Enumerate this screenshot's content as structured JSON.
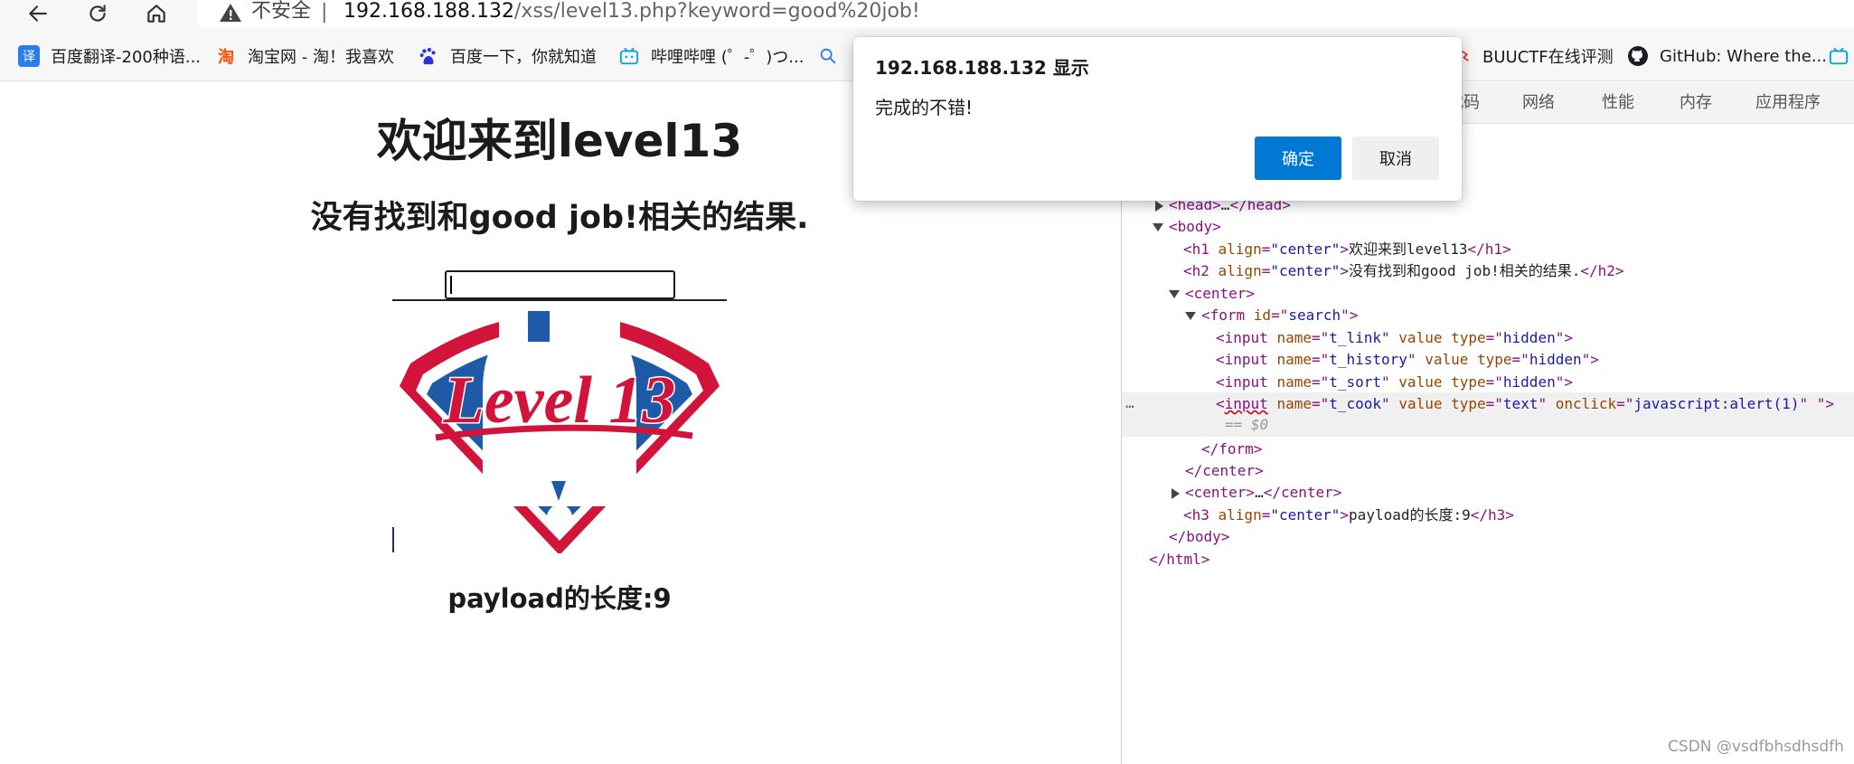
{
  "toolbar": {
    "security_label": "不安全",
    "separator": "|",
    "url_host": "192.168.188.132",
    "url_path": "/xss/level13.php?keyword=good%20job!"
  },
  "favorites": [
    {
      "label": "百度翻译-200种语...",
      "icon": "translate-icon",
      "icon_text": "译",
      "color": "#2b7de9"
    },
    {
      "label": "淘宝网 - 淘！我喜欢",
      "icon": "taobao-icon",
      "icon_text": "淘",
      "color": "#ff5000"
    },
    {
      "label": "百度一下，你就知道",
      "icon": "baidu-paw-icon",
      "icon_text": "",
      "color": "#2932e1"
    },
    {
      "label": "哔哩哔哩 (゜-゜)つ...",
      "icon": "bilibili-icon",
      "icon_text": "",
      "color": "#00a1d6"
    },
    {
      "label": "BUUCTF在线评测",
      "icon": "buuctf-icon",
      "icon_text": "",
      "color": "#e0383e"
    },
    {
      "label": "GitHub: Where the...",
      "icon": "github-icon",
      "icon_text": "",
      "color": "#1b1f23"
    }
  ],
  "page": {
    "h1": "欢迎来到level13",
    "h2": "没有找到和good job!相关的结果.",
    "h3": "payload的长度:9",
    "logo_text": "Level 13"
  },
  "devtools": {
    "tabs": [
      "代码",
      "网络",
      "性能",
      "内存",
      "应用程序"
    ],
    "dom": {
      "head": [
        "<",
        "head",
        ">…</",
        "head",
        ">"
      ],
      "body_open": "body",
      "h1_text": "欢迎来到level13",
      "h2_text": "没有找到和good job!相关的结果.",
      "center": "center",
      "form_id": "search",
      "inputs": [
        {
          "name": "t_link",
          "type": "hidden"
        },
        {
          "name": "t_history",
          "type": "hidden"
        },
        {
          "name": "t_sort",
          "type": "hidden"
        },
        {
          "name": "t_cook",
          "type": "text",
          "onclick": "javascript:alert(1)"
        }
      ],
      "selected_suffix": "== $0",
      "h3_text": "payload的长度:9",
      "attr_align": "align",
      "attr_align_val": "\"center\"",
      "attr_id": "id",
      "attr_name": "name",
      "attr_value": "value",
      "attr_type": "type",
      "attr_onclick": "onclick",
      "ellipsis": "…",
      "dots": "···"
    }
  },
  "dialog": {
    "title": "192.168.188.132 显示",
    "message": "完成的不错!",
    "ok_label": "确定",
    "cancel_label": "取消"
  },
  "watermark": "CSDN @vsdfbhsdhsdfh",
  "colors": {
    "primary_button": "#0078d4",
    "logo_red": "#d2143a",
    "logo_blue": "#1e5aa8"
  }
}
